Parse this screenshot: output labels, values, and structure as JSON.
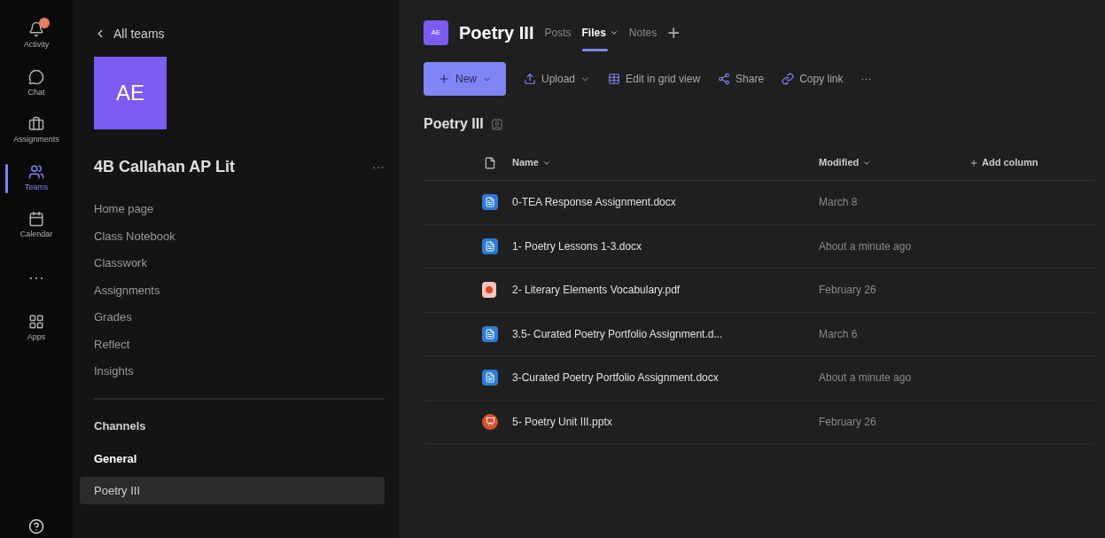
{
  "rail": [
    {
      "label": "Activity",
      "selected": false,
      "badge": true
    },
    {
      "label": "Chat",
      "selected": false,
      "badge": false
    },
    {
      "label": "Assignments",
      "selected": false,
      "badge": false
    },
    {
      "label": "Teams",
      "selected": true,
      "badge": false
    },
    {
      "label": "Calendar",
      "selected": false,
      "badge": false
    },
    {
      "label": "···",
      "selected": false,
      "badge": false
    },
    {
      "label": "Apps",
      "selected": false,
      "badge": false
    }
  ],
  "sidebar": {
    "back": "All teams",
    "avatar": "AE",
    "team_name": "4B Callahan AP Lit",
    "more": "···",
    "items": [
      "Home page",
      "Class Notebook",
      "Classwork",
      "Assignments",
      "Grades",
      "Reflect",
      "Insights"
    ],
    "channels_heading": "Channels",
    "channels": [
      {
        "label": "General",
        "bold": true,
        "selected": false
      },
      {
        "label": "Poetry III",
        "bold": false,
        "selected": true
      }
    ]
  },
  "header": {
    "avatar": "AE",
    "title": "Poetry III",
    "tabs": [
      {
        "label": "Posts",
        "selected": false,
        "caret": false
      },
      {
        "label": "Files",
        "selected": true,
        "caret": true
      },
      {
        "label": "Notes",
        "selected": false,
        "caret": false
      }
    ],
    "add": "+"
  },
  "toolbar": [
    {
      "kind": "primary",
      "label": "New"
    },
    {
      "kind": "upload",
      "label": "Upload"
    },
    {
      "kind": "grid",
      "label": "Edit in grid view"
    },
    {
      "kind": "share",
      "label": "Share"
    },
    {
      "kind": "link",
      "label": "Copy link"
    },
    {
      "kind": "more",
      "label": "···"
    }
  ],
  "folder_title": "Poetry III",
  "table": {
    "columns": [
      "Name",
      "Modified",
      "Add column"
    ],
    "rows": [
      {
        "kind": "docx",
        "name": "0-TEA Response Assignment.docx",
        "modified": "March 8"
      },
      {
        "kind": "docx",
        "name": "1- Poetry Lessons 1-3.docx",
        "modified": "About a minute ago"
      },
      {
        "kind": "pdf",
        "name": "2- Literary Elements Vocabulary.pdf",
        "modified": "February 26"
      },
      {
        "kind": "docx",
        "name": "3.5- Curated Poetry Portfolio Assignment.d...",
        "modified": "March 6"
      },
      {
        "kind": "docx",
        "name": "3-Curated Poetry Portfolio Assignment.docx",
        "modified": "About a minute ago"
      },
      {
        "kind": "pptx",
        "name": "5- Poetry Unit III.pptx",
        "modified": "February 26"
      }
    ]
  }
}
